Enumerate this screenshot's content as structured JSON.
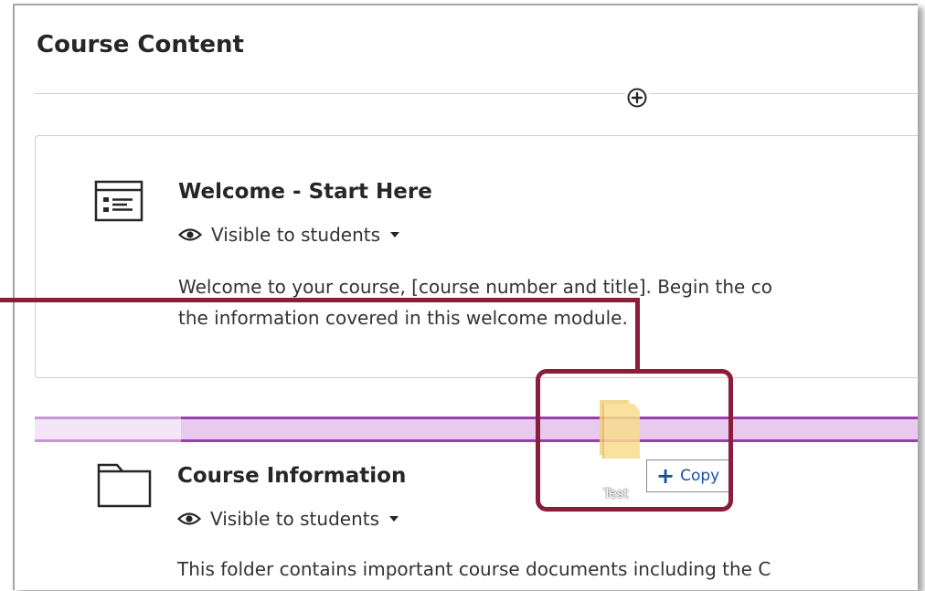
{
  "page": {
    "title": "Course Content"
  },
  "items": [
    {
      "title": "Welcome - Start Here",
      "visibility": "Visible to students",
      "description_lines": [
        "Welcome to your course, [course number and title]. Begin the co",
        "the information covered in this welcome module."
      ],
      "icon": "learning-module-icon"
    },
    {
      "title": "Course Information",
      "visibility": "Visible to students",
      "description_lines": [
        "This folder contains important course documents including the C"
      ],
      "icon": "folder-icon"
    }
  ],
  "drag": {
    "file_name": "Test",
    "action_label": "Copy",
    "icon": "folder-icon"
  },
  "colors": {
    "callout": "#8b1d3a",
    "drop_target": "#9a3fb0",
    "drop_fill": "#e8c9ef",
    "copy_text": "#1a4fa8"
  }
}
